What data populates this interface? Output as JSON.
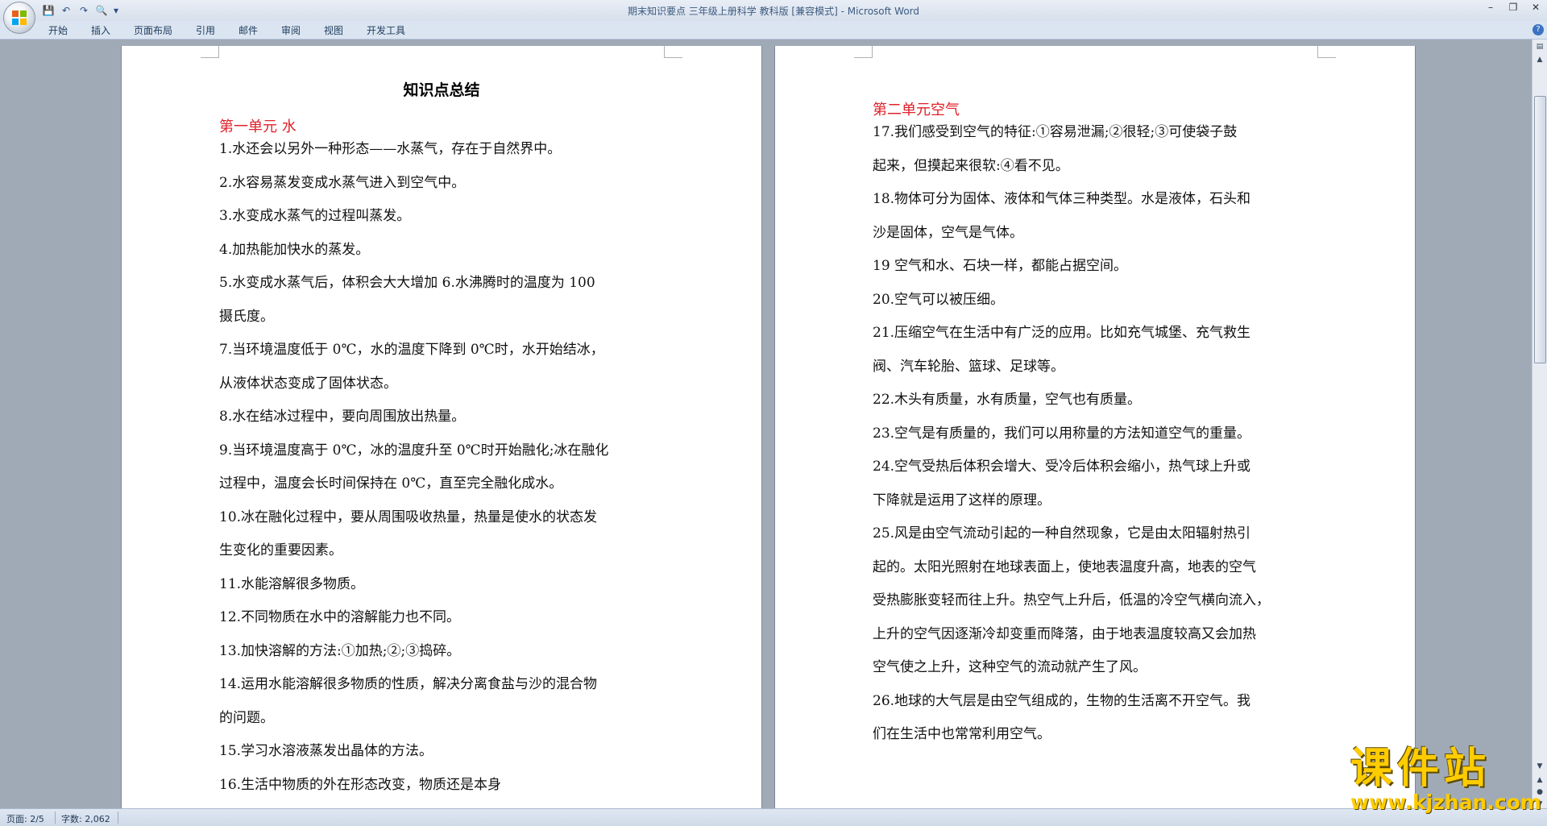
{
  "window": {
    "title": "期末知识要点 三年级上册科学 教科版 [兼容模式] - Microsoft Word"
  },
  "ribbon": {
    "tabs": [
      "开始",
      "插入",
      "页面布局",
      "引用",
      "邮件",
      "审阅",
      "视图",
      "开发工具"
    ]
  },
  "left_page": {
    "title": "知识点总结",
    "heading": "第一单元 水",
    "lines": [
      "1.水还会以另外一种形态——水蒸气，存在于自然界中。",
      "2.水容易蒸发变成水蒸气进入到空气中。",
      "3.水变成水蒸气的过程叫蒸发。",
      "4.加热能加快水的蒸发。",
      "5.水变成水蒸气后，体积会大大增加 6.水沸腾时的温度为 100",
      "摄氏度。",
      "7.当环境温度低于 0℃，水的温度下降到 0℃时，水开始结冰，",
      "从液体状态变成了固体状态。",
      "8.水在结冰过程中，要向周围放出热量。",
      "9.当环境温度高于 0℃，冰的温度升至 0℃时开始融化;冰在融化",
      "过程中，温度会长时间保持在 0℃，直至完全融化成水。",
      "10.冰在融化过程中，要从周围吸收热量，热量是使水的状态发",
      "生变化的重要因素。",
      "11.水能溶解很多物质。",
      "12.不同物质在水中的溶解能力也不同。",
      "13.加快溶解的方法:①加热;②;③捣碎。",
      "14.运用水能溶解很多物质的性质，解决分离食盐与沙的混合物",
      "的问题。",
      "15.学习水溶液蒸发出晶体的方法。",
      "16.生活中物质的外在形态改变，物质还是本身"
    ]
  },
  "right_page": {
    "heading": "第二单元空气",
    "lines": [
      "17.我们感受到空气的特征:①容易泄漏;②很轻;③可使袋子鼓",
      "起来，但摸起来很软:④看不见。",
      "18.物体可分为固体、液体和气体三种类型。水是液体，石头和",
      "沙是固体，空气是气体。",
      "19 空气和水、石块一样，都能占据空间。",
      "20.空气可以被压细。",
      "21.压缩空气在生活中有广泛的应用。比如充气城堡、充气救生",
      "阀、汽车轮胎、篮球、足球等。",
      "22.木头有质量，水有质量，空气也有质量。",
      "23.空气是有质量的，我们可以用称量的方法知道空气的重量。",
      "24.空气受热后体积会增大、受冷后体积会缩小，热气球上升或",
      "下降就是运用了这样的原理。",
      "25.风是由空气流动引起的一种自然现象，它是由太阳辐射热引",
      "起的。太阳光照射在地球表面上，使地表温度升高，地表的空气",
      "受热膨胀变轻而往上升。热空气上升后，低温的冷空气横向流入，",
      "上升的空气因逐渐冷却变重而降落，由于地表温度较高又会加热",
      "空气使之上升，这种空气的流动就产生了风。",
      "26.地球的大气层是由空气组成的，生物的生活离不开空气。我",
      "们在生活中也常常利用空气。"
    ]
  },
  "status": {
    "page": "页面: 2/5",
    "words": "字数: 2,062"
  },
  "watermark": {
    "main": "课件站",
    "url": "www.kjzhan.com"
  },
  "colors": {
    "heading_red": "#e0202a",
    "watermark_yellow": "#ffcc00"
  }
}
